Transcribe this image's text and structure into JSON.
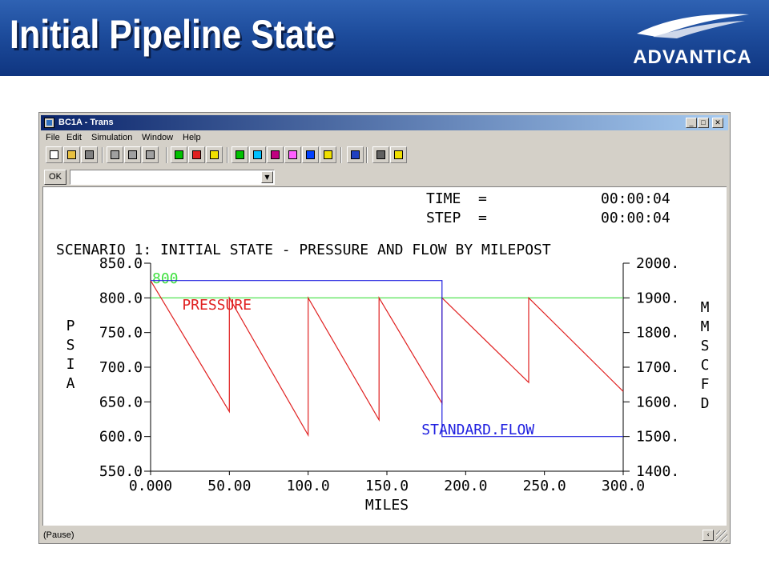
{
  "slide": {
    "title": "Initial Pipeline State",
    "logo_text": "ADVANTICA"
  },
  "window": {
    "title": "BC1A - Trans",
    "min_glyph": "_",
    "max_glyph": "□",
    "close_glyph": "✕"
  },
  "menu": [
    {
      "label": "File"
    },
    {
      "label": "Edit"
    },
    {
      "label": "Simulation"
    },
    {
      "label": "Window"
    },
    {
      "label": "Help"
    }
  ],
  "toolbar": [
    {
      "icon": "new-icon",
      "color": "#ffffff"
    },
    {
      "icon": "open-icon",
      "color": "#e8c040"
    },
    {
      "icon": "save-icon",
      "color": "#808080"
    },
    {
      "icon": "cut-icon",
      "color": "#a0a0a0"
    },
    {
      "icon": "copy-icon",
      "color": "#a0a0a0"
    },
    {
      "icon": "paste-icon",
      "color": "#a0a0a0"
    },
    {
      "icon": "run-icon",
      "color": "#00c000"
    },
    {
      "icon": "pause-icon",
      "color": "#e02020"
    },
    {
      "icon": "step-icon",
      "color": "#f0e000"
    },
    {
      "icon": "graph-icon",
      "color": "#00c000"
    },
    {
      "icon": "clock-icon",
      "color": "#00c0ff"
    },
    {
      "icon": "network-icon",
      "color": "#c00080"
    },
    {
      "icon": "table-icon",
      "color": "#ff60ff"
    },
    {
      "icon": "window-icon",
      "color": "#0040ff"
    },
    {
      "icon": "chart-icon",
      "color": "#f0e000"
    },
    {
      "icon": "refresh-icon",
      "color": "#2040c0"
    },
    {
      "icon": "print-icon",
      "color": "#606060"
    },
    {
      "icon": "help-icon",
      "color": "#f0e000"
    }
  ],
  "command": {
    "ok_label": "OK",
    "value": "",
    "dropdown_glyph": "▼"
  },
  "readout": {
    "time_label": "TIME  =",
    "time_value": "00:00:04",
    "step_label": "STEP  =",
    "step_value": "00:00:04"
  },
  "chart_data": {
    "type": "line",
    "title": "SCENARIO 1: INITIAL STATE - PRESSURE AND FLOW BY MILEPOST",
    "xlabel": "MILES",
    "ylabel_left": "PSIA",
    "ylabel_right": "MMSCFD",
    "xlim": [
      0,
      300
    ],
    "ylim_left": [
      550,
      850
    ],
    "ylim_right": [
      1400,
      2000
    ],
    "x_ticks": [
      "0.000",
      "50.00",
      "100.0",
      "150.0",
      "200.0",
      "250.0",
      "300.0"
    ],
    "y_ticks_left": [
      "850.0",
      "800.0",
      "750.0",
      "700.0",
      "650.0",
      "600.0",
      "550.0"
    ],
    "y_ticks_right": [
      "2000.",
      "1900.",
      "1800.",
      "1700.",
      "1600.",
      "1500.",
      "1400."
    ],
    "reference_line": {
      "label": "800",
      "value": 800,
      "color": "#40e040"
    },
    "series": [
      {
        "name": "PRESSURE",
        "axis": "left",
        "color": "#e02020",
        "x": [
          0,
          50,
          50,
          100,
          100,
          145,
          145,
          185,
          185,
          240,
          240,
          300
        ],
        "y": [
          825,
          636,
          800,
          602,
          800,
          624,
          800,
          648,
          800,
          678,
          800,
          665
        ]
      },
      {
        "name": "STANDARD.FLOW",
        "axis": "right",
        "color": "#2020e0",
        "x": [
          0,
          185,
          185,
          300
        ],
        "y": [
          1950,
          1950,
          1500,
          1500
        ]
      }
    ]
  },
  "status": {
    "text": "(Pause)",
    "scroll_glyph": "‹"
  }
}
